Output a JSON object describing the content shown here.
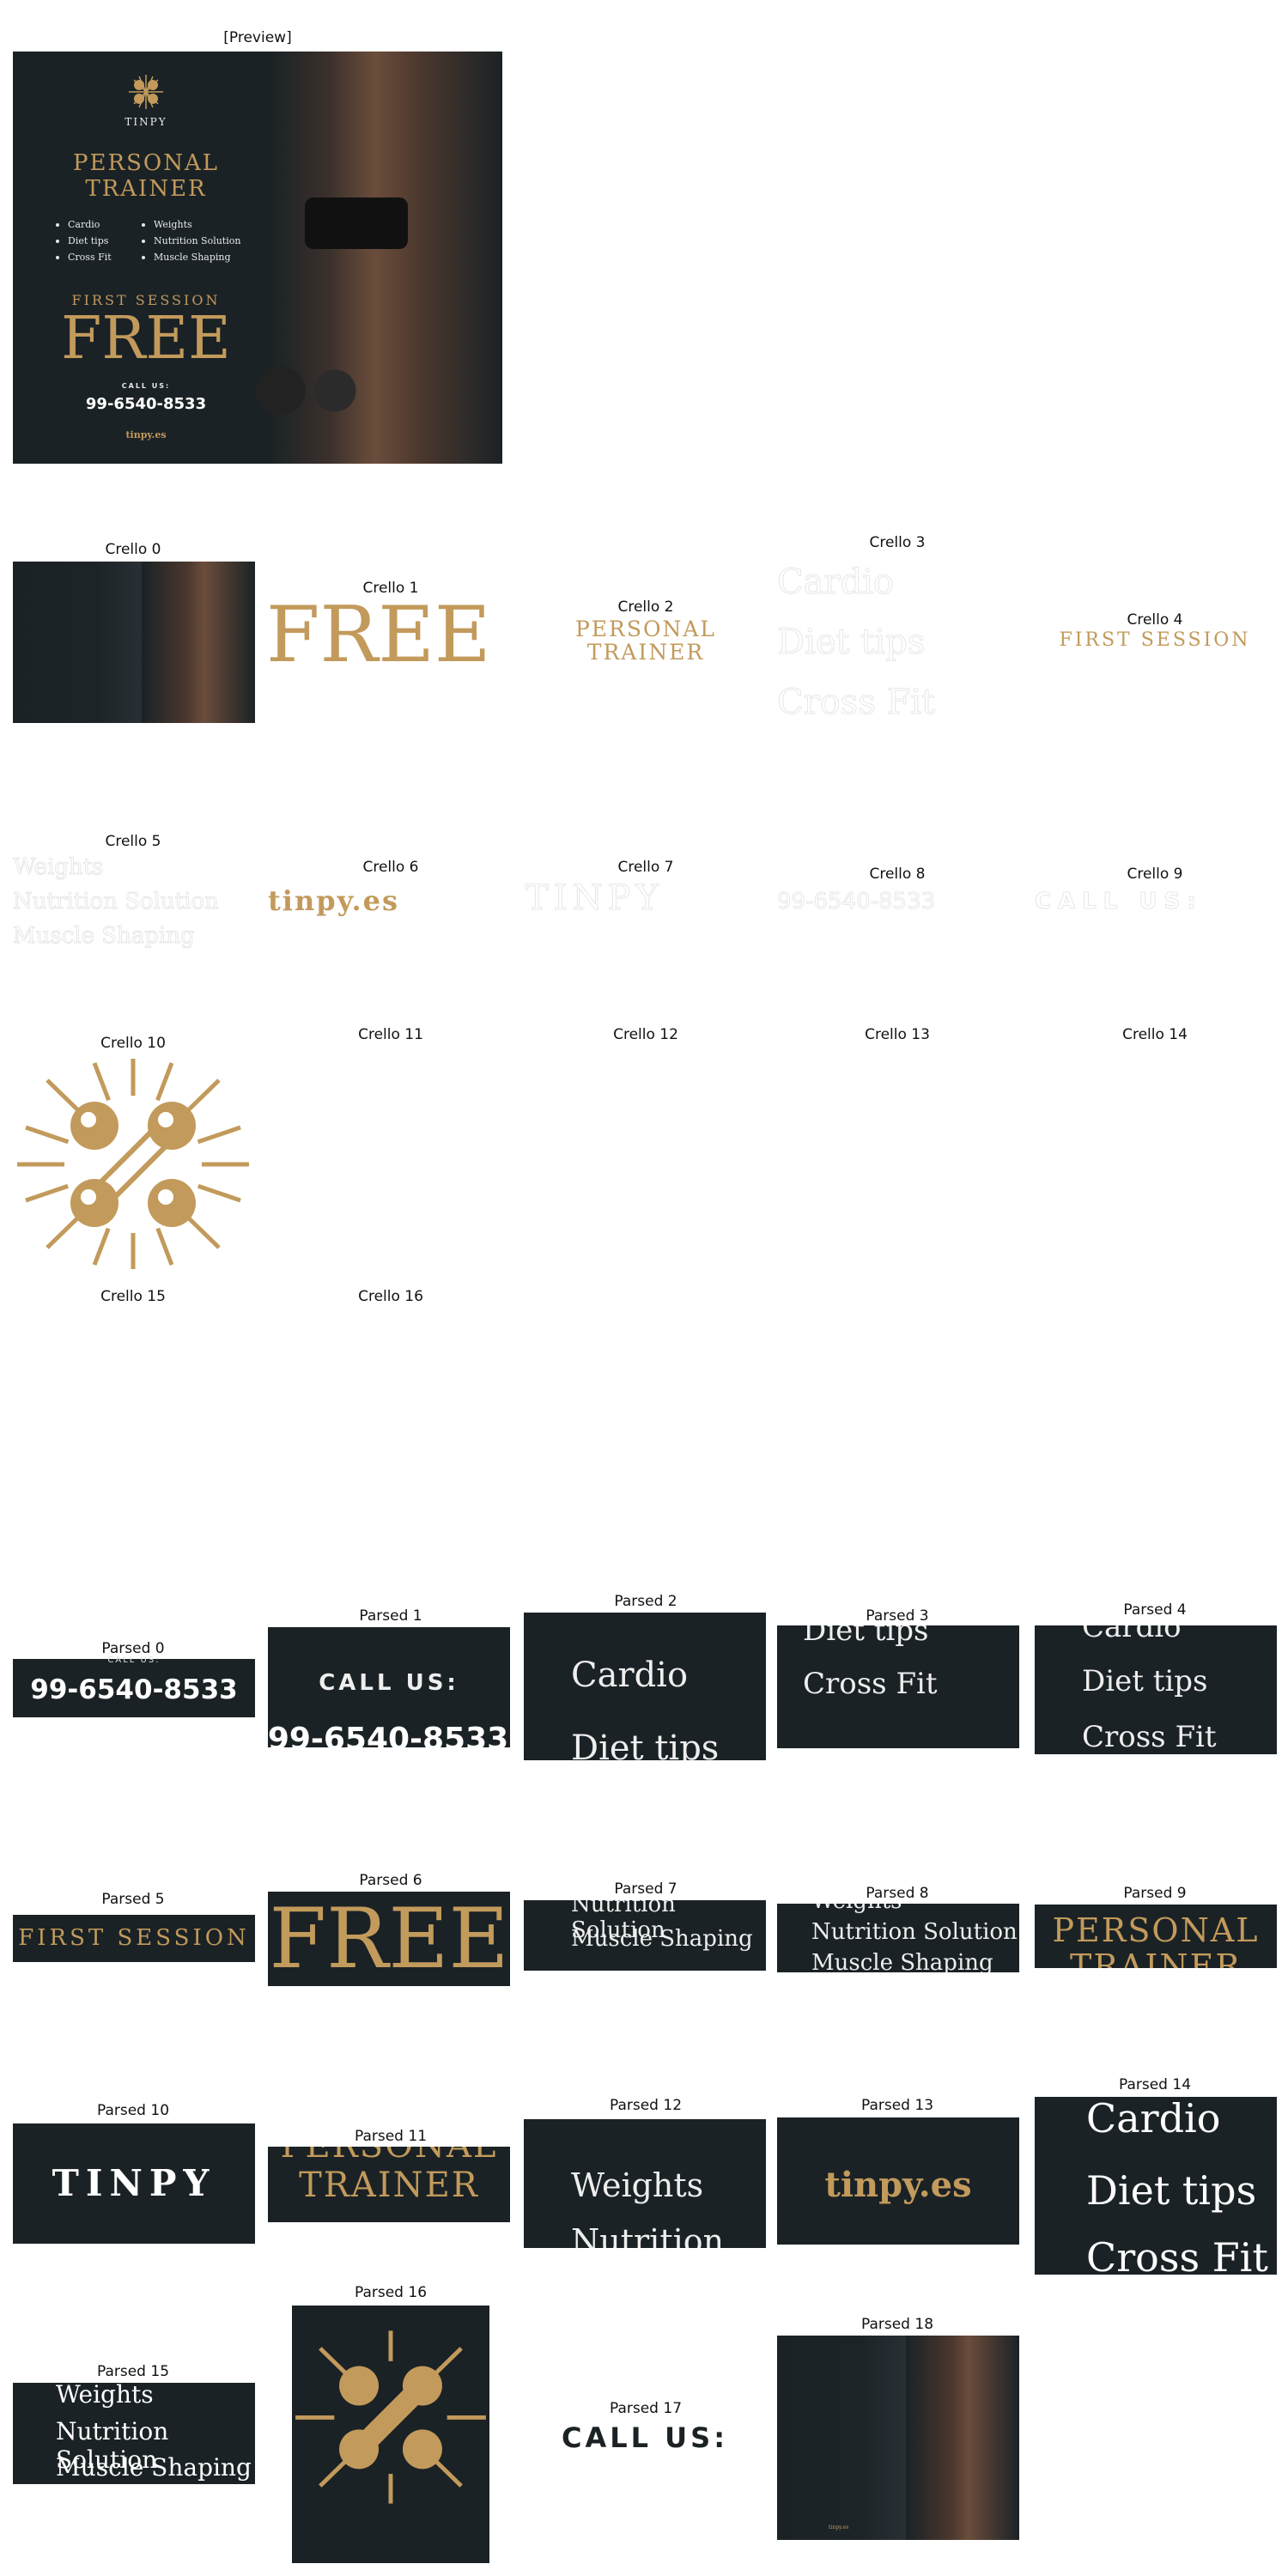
{
  "labels": {
    "preview": "[Preview]",
    "crello": [
      "Crello 0",
      "Crello 1",
      "Crello 2",
      "Crello 3",
      "Crello 4",
      "Crello 5",
      "Crello 6",
      "Crello 7",
      "Crello 8",
      "Crello 9",
      "Crello 10",
      "Crello 11",
      "Crello 12",
      "Crello 13",
      "Crello 14",
      "Crello 15",
      "Crello 16"
    ],
    "parsed": [
      "Parsed 0",
      "Parsed 1",
      "Parsed 2",
      "Parsed 3",
      "Parsed 4",
      "Parsed 5",
      "Parsed 6",
      "Parsed 7",
      "Parsed 8",
      "Parsed 9",
      "Parsed 10",
      "Parsed 11",
      "Parsed 12",
      "Parsed 13",
      "Parsed 14",
      "Parsed 15",
      "Parsed 16",
      "Parsed 17",
      "Parsed 18"
    ]
  },
  "poster": {
    "brand": "TINPY",
    "title_line1": "PERSONAL",
    "title_line2": "TRAINER",
    "list_left": [
      "Cardio",
      "Diet tips",
      "Cross Fit"
    ],
    "list_right": [
      "Weights",
      "Nutrition Solution",
      "Muscle Shaping"
    ],
    "first_session": "FIRST SESSION",
    "free": "FREE",
    "call_us": "CALL US:",
    "phone": "99-6540-8533",
    "website": "tinpy.es"
  },
  "colors": {
    "gold": "#c29a5b",
    "background": "#1b2226",
    "text_light": "#e9e9e9"
  },
  "icons": {
    "logo": "dumbbell-sunburst-icon"
  }
}
